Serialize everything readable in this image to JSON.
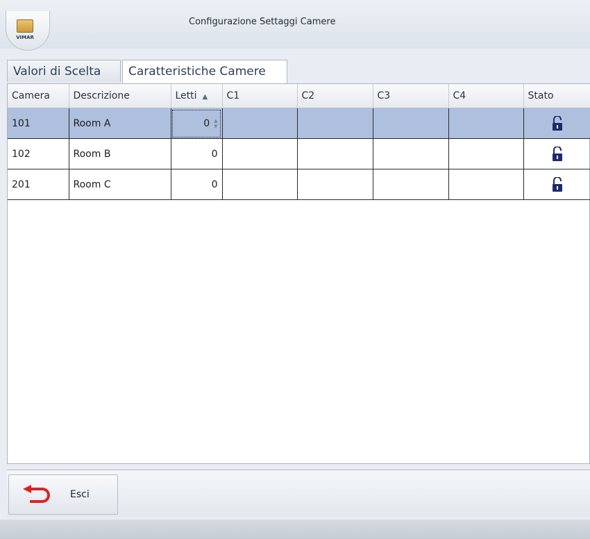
{
  "window": {
    "title": "Configurazione Settaggi Camere",
    "logo_text": "VIMAR"
  },
  "tabs": [
    {
      "label": "Valori di Scelta"
    },
    {
      "label": "Caratteristiche Camere"
    }
  ],
  "grid": {
    "columns": [
      "Camera",
      "Descrizione",
      "Letti",
      "C1",
      "C2",
      "C3",
      "C4",
      "Stato"
    ],
    "sort_column": "Letti",
    "rows": [
      {
        "camera": "101",
        "descrizione": "Room A",
        "letti": "0",
        "c1": "",
        "c2": "",
        "c3": "",
        "c4": "",
        "stato": "unlocked-icon"
      },
      {
        "camera": "102",
        "descrizione": "Room B",
        "letti": "0",
        "c1": "",
        "c2": "",
        "c3": "",
        "c4": "",
        "stato": "unlocked-icon"
      },
      {
        "camera": "201",
        "descrizione": "Room C",
        "letti": "0",
        "c1": "",
        "c2": "",
        "c3": "",
        "c4": "",
        "stato": "unlocked-icon"
      }
    ]
  },
  "toolbar": {
    "exit_label": "Esci"
  },
  "colors": {
    "selected_row": "#aec0de",
    "lock_icon": "#1f2a6b",
    "exit_arrow": "#e02020"
  }
}
